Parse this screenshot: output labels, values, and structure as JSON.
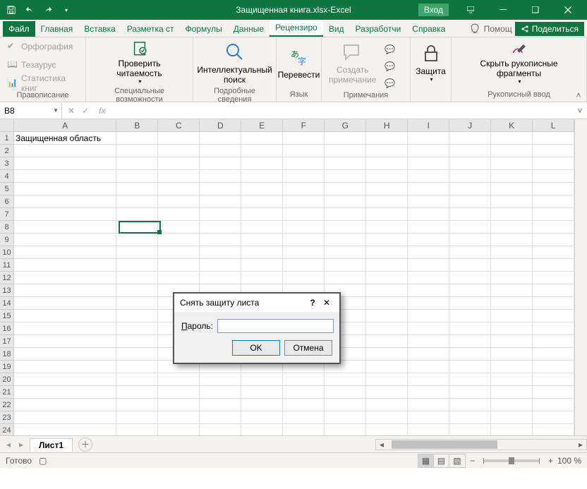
{
  "titlebar": {
    "filename": "Защищенная книга.xlsx",
    "app": "Excel",
    "sep": " - ",
    "login": "Вход"
  },
  "tabs": {
    "items": [
      "Файл",
      "Главная",
      "Вставка",
      "Разметка ст",
      "Формулы",
      "Данные",
      "Рецензиро",
      "Вид",
      "Разработчи",
      "Справка"
    ],
    "active": 6,
    "help": "Помощ",
    "share": "Поделиться"
  },
  "ribbon": {
    "proofing": {
      "label": "Правописание",
      "spelling": "Орфография",
      "thesaurus": "Тезаурус",
      "stats": "Статистика книг"
    },
    "accessibility": {
      "label": "Специальные возможности",
      "check": "Проверить\nчитаемость"
    },
    "insights": {
      "label": "Подробные сведения",
      "smart": "Интеллектуальный\nпоиск"
    },
    "language": {
      "label": "Язык",
      "translate": "Перевести"
    },
    "comments": {
      "label": "Примечания",
      "new": "Создать\nпримечание"
    },
    "protect": {
      "label": "",
      "btn": "Защита"
    },
    "ink": {
      "label": "Рукописный ввод",
      "hide": "Скрыть рукописные\nфрагменты"
    }
  },
  "namebar": {
    "ref": "B8"
  },
  "columns": [
    "A",
    "B",
    "C",
    "D",
    "E",
    "F",
    "G",
    "H",
    "I",
    "J",
    "K",
    "L"
  ],
  "rows": [
    "1",
    "2",
    "3",
    "4",
    "5",
    "6",
    "7",
    "8",
    "9",
    "10",
    "11",
    "12",
    "13",
    "14",
    "15",
    "16",
    "17",
    "18",
    "19",
    "20",
    "21",
    "22",
    "23",
    "24"
  ],
  "a1": "Защищенная область",
  "sheet": {
    "name": "Лист1"
  },
  "status": {
    "ready": "Готово",
    "zoom": "100 %"
  },
  "dialog": {
    "title": "Снять защиту листа",
    "pw_u": "П",
    "pw_rest": "ароль:",
    "ok": "OK",
    "cancel": "Отмена"
  }
}
